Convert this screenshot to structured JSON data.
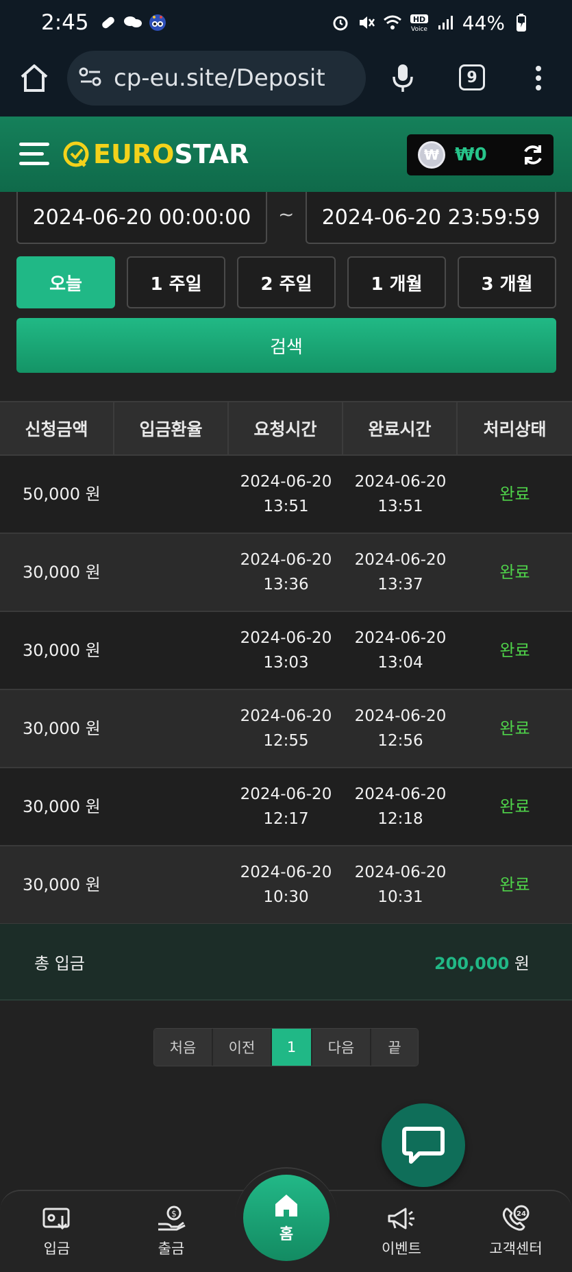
{
  "status_bar": {
    "time": "2:45",
    "battery": "44%",
    "network_badge": "HD Voice"
  },
  "browser": {
    "url": "cp-eu.site/Deposit",
    "tab_count": "9"
  },
  "header": {
    "logo_part_a": "EURO",
    "logo_part_b": "STAR",
    "currency_symbol": "₩",
    "balance": "₩0"
  },
  "filter": {
    "start_date": "2024-06-20 00:00:00",
    "separator": "~",
    "end_date": "2024-06-20 23:59:59",
    "periods": [
      "오늘",
      "1 주일",
      "2 주일",
      "1 개월",
      "3 개월"
    ],
    "active_period_index": 0,
    "search_label": "검색"
  },
  "table": {
    "headers": [
      "신청금액",
      "입금환율",
      "요청시간",
      "완료시간",
      "처리상태"
    ],
    "rows": [
      {
        "amount": "50,000 원",
        "rate": "",
        "req_date": "2024-06-20",
        "req_time": "13:51",
        "done_date": "2024-06-20",
        "done_time": "13:51",
        "status": "완료"
      },
      {
        "amount": "30,000 원",
        "rate": "",
        "req_date": "2024-06-20",
        "req_time": "13:36",
        "done_date": "2024-06-20",
        "done_time": "13:37",
        "status": "완료"
      },
      {
        "amount": "30,000 원",
        "rate": "",
        "req_date": "2024-06-20",
        "req_time": "13:03",
        "done_date": "2024-06-20",
        "done_time": "13:04",
        "status": "완료"
      },
      {
        "amount": "30,000 원",
        "rate": "",
        "req_date": "2024-06-20",
        "req_time": "12:55",
        "done_date": "2024-06-20",
        "done_time": "12:56",
        "status": "완료"
      },
      {
        "amount": "30,000 원",
        "rate": "",
        "req_date": "2024-06-20",
        "req_time": "12:17",
        "done_date": "2024-06-20",
        "done_time": "12:18",
        "status": "완료"
      },
      {
        "amount": "30,000 원",
        "rate": "",
        "req_date": "2024-06-20",
        "req_time": "10:30",
        "done_date": "2024-06-20",
        "done_time": "10:31",
        "status": "완료"
      }
    ],
    "total_label": "총 입금",
    "total_value": "200,000",
    "total_unit": "원"
  },
  "pagination": {
    "first": "처음",
    "prev": "이전",
    "current": "1",
    "next": "다음",
    "last": "끝"
  },
  "bottom_nav": {
    "deposit": "입금",
    "withdraw": "출금",
    "home": "홈",
    "event": "이벤트",
    "support": "고객센터"
  },
  "colors": {
    "accent": "#20b886",
    "header_green": "#127150",
    "status_done": "#4fd34a",
    "logo_yellow": "#f3d21b"
  }
}
